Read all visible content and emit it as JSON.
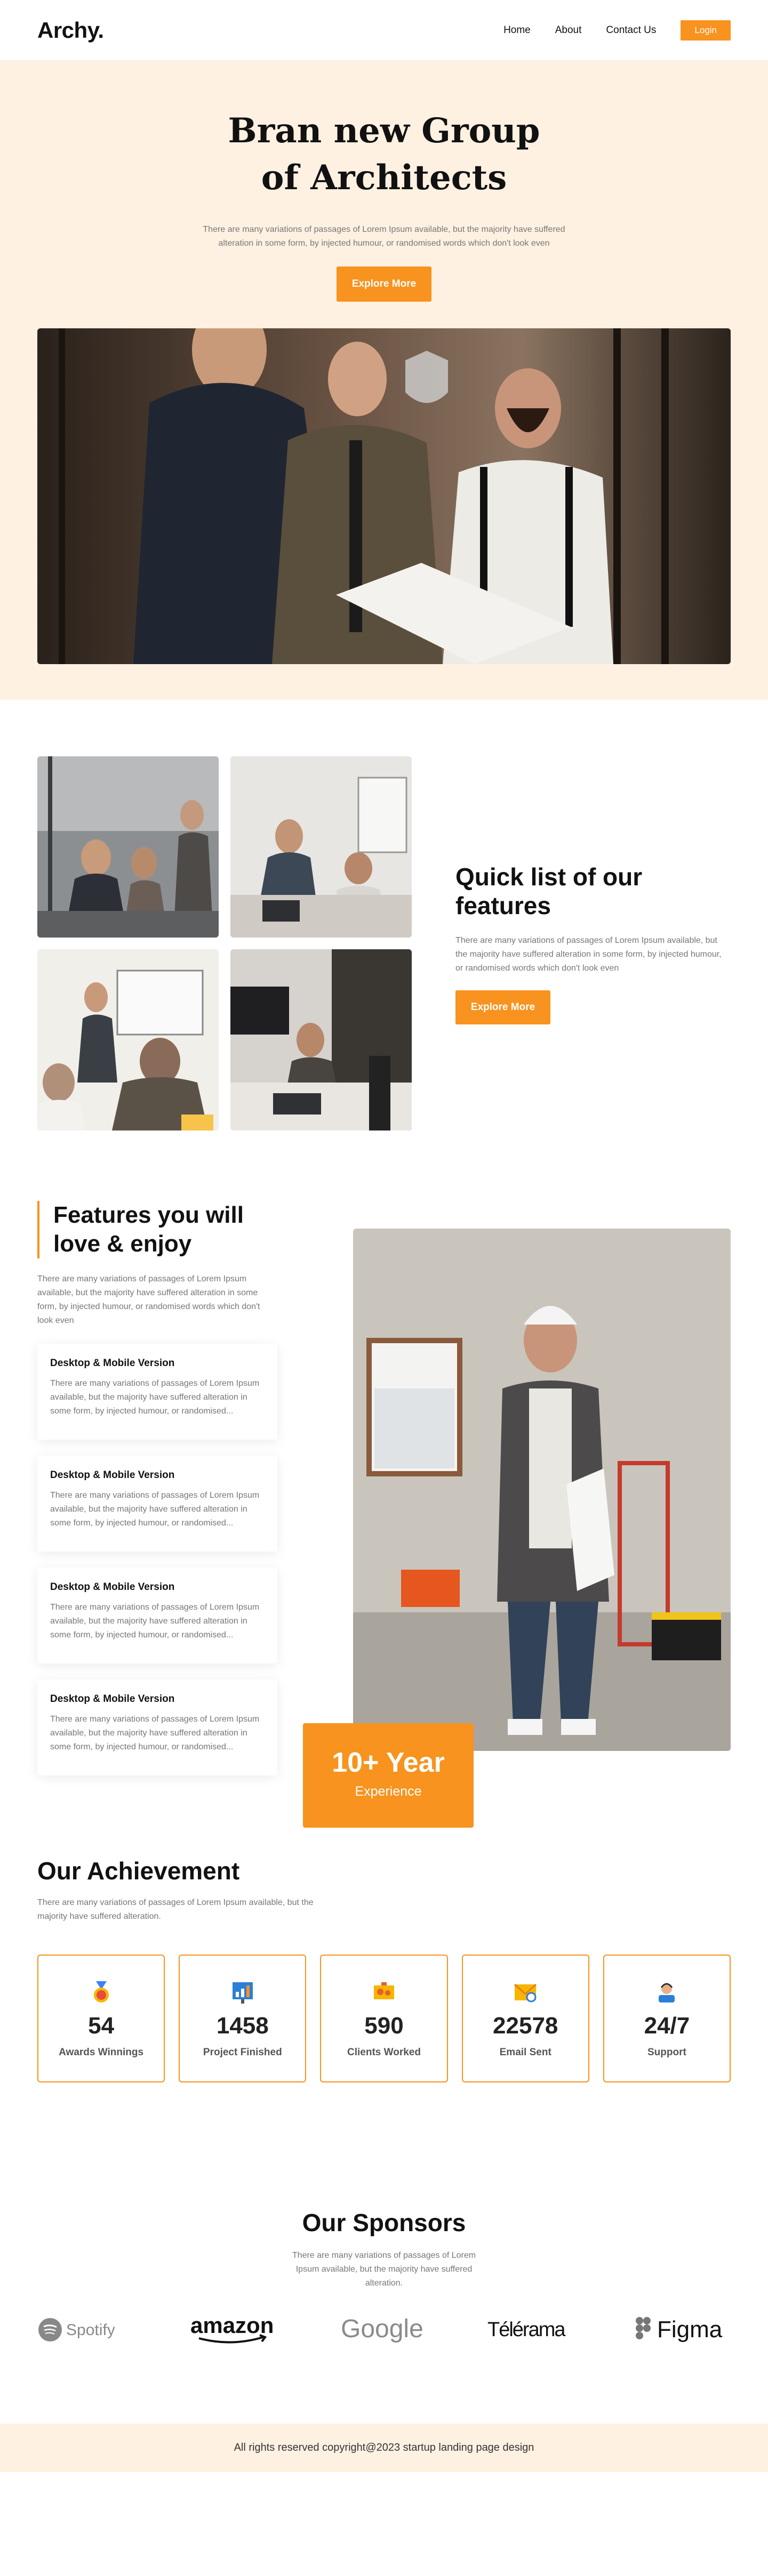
{
  "nav": {
    "logo": "Archy.",
    "links": [
      "Home",
      "About",
      "Contact Us"
    ],
    "login": "Login"
  },
  "hero": {
    "title": "Bran new Group of Architects",
    "subtitle": "There are many variations of passages of Lorem Ipsum available, but the majority have suffered alteration in some form, by injected humour, or randomised words which don't look even",
    "cta": "Explore More"
  },
  "quick": {
    "title": "Quick list of our features",
    "text": "There are many variations of passages of Lorem Ipsum available, but the majority have suffered alteration in some form, by injected humour, or randomised words which don't look even",
    "cta": "Explore More"
  },
  "features": {
    "title": "Features you will love & enjoy",
    "intro": "There are many variations of passages of Lorem Ipsum available, but the majority have suffered alteration in some form, by injected humour, or randomised words which don't look even",
    "cards": [
      {
        "title": "Desktop & Mobile Version",
        "text": "There are many variations of passages of Lorem Ipsum available, but the majority have suffered alteration in some form, by injected humour, or randomised..."
      },
      {
        "title": "Desktop & Mobile Version",
        "text": "There are many variations of passages of Lorem Ipsum available, but the majority have suffered alteration in some form, by injected humour, or randomised..."
      },
      {
        "title": "Desktop & Mobile Version",
        "text": "There are many variations of passages of Lorem Ipsum available, but the majority have suffered alteration in some form, by injected humour, or randomised..."
      },
      {
        "title": "Desktop & Mobile Version",
        "text": "There are many variations of passages of Lorem Ipsum available, but the majority have suffered alteration in some form, by injected humour, or randomised..."
      }
    ],
    "badge_big": "10+ Year",
    "badge_small": "Experience"
  },
  "achievement": {
    "title": "Our Achievement",
    "intro": "There are many variations of passages of Lorem Ipsum available, but the majority have suffered alteration.",
    "stats": [
      {
        "value": "54",
        "label": "Awards Winnings",
        "icon": "medal-icon"
      },
      {
        "value": "1458",
        "label": "Project Finished",
        "icon": "chart-board-icon"
      },
      {
        "value": "590",
        "label": "Clients Worked",
        "icon": "world-map-icon"
      },
      {
        "value": "22578",
        "label": "Email Sent",
        "icon": "envelope-icon"
      },
      {
        "value": "24/7",
        "label": "Support",
        "icon": "support-agent-icon"
      }
    ]
  },
  "sponsors": {
    "title": "Our Sponsors",
    "intro": "There are many variations of passages of Lorem Ipsum available, but the majority have suffered alteration.",
    "logos": [
      "Spotify",
      "amazon",
      "Google",
      "Télérama",
      "Figma"
    ]
  },
  "footer": {
    "text": "All rights reserved copyright@2023 startup landing page design"
  },
  "colors": {
    "accent": "#f7931e",
    "hero_bg": "#fff1e2"
  }
}
